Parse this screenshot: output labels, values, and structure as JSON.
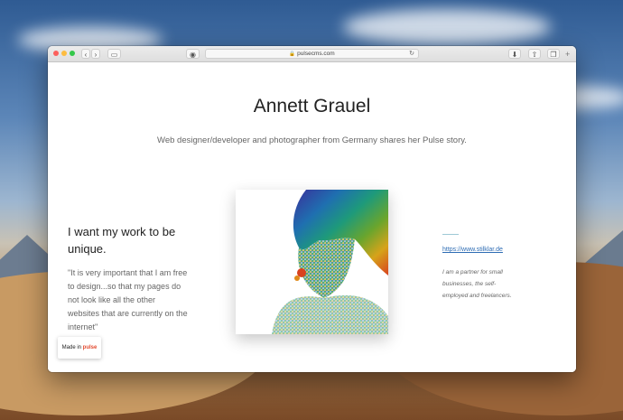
{
  "browser": {
    "url": "pulsecms.com"
  },
  "page": {
    "title": "Annett Grauel",
    "subtitle": "Web designer/developer and photographer from Germany shares her Pulse story.",
    "headline": "I want my work to be unique.",
    "quote": "\"It is very important that I am free to design...so that my pages do not look like all the other websites that are currently on the internet\"",
    "link": "https://www.stilklar.de",
    "note": "I am a partner for small businesses, the self-employed and freelancers."
  },
  "badge": {
    "prefix": "Made in ",
    "brand": "pulse"
  }
}
